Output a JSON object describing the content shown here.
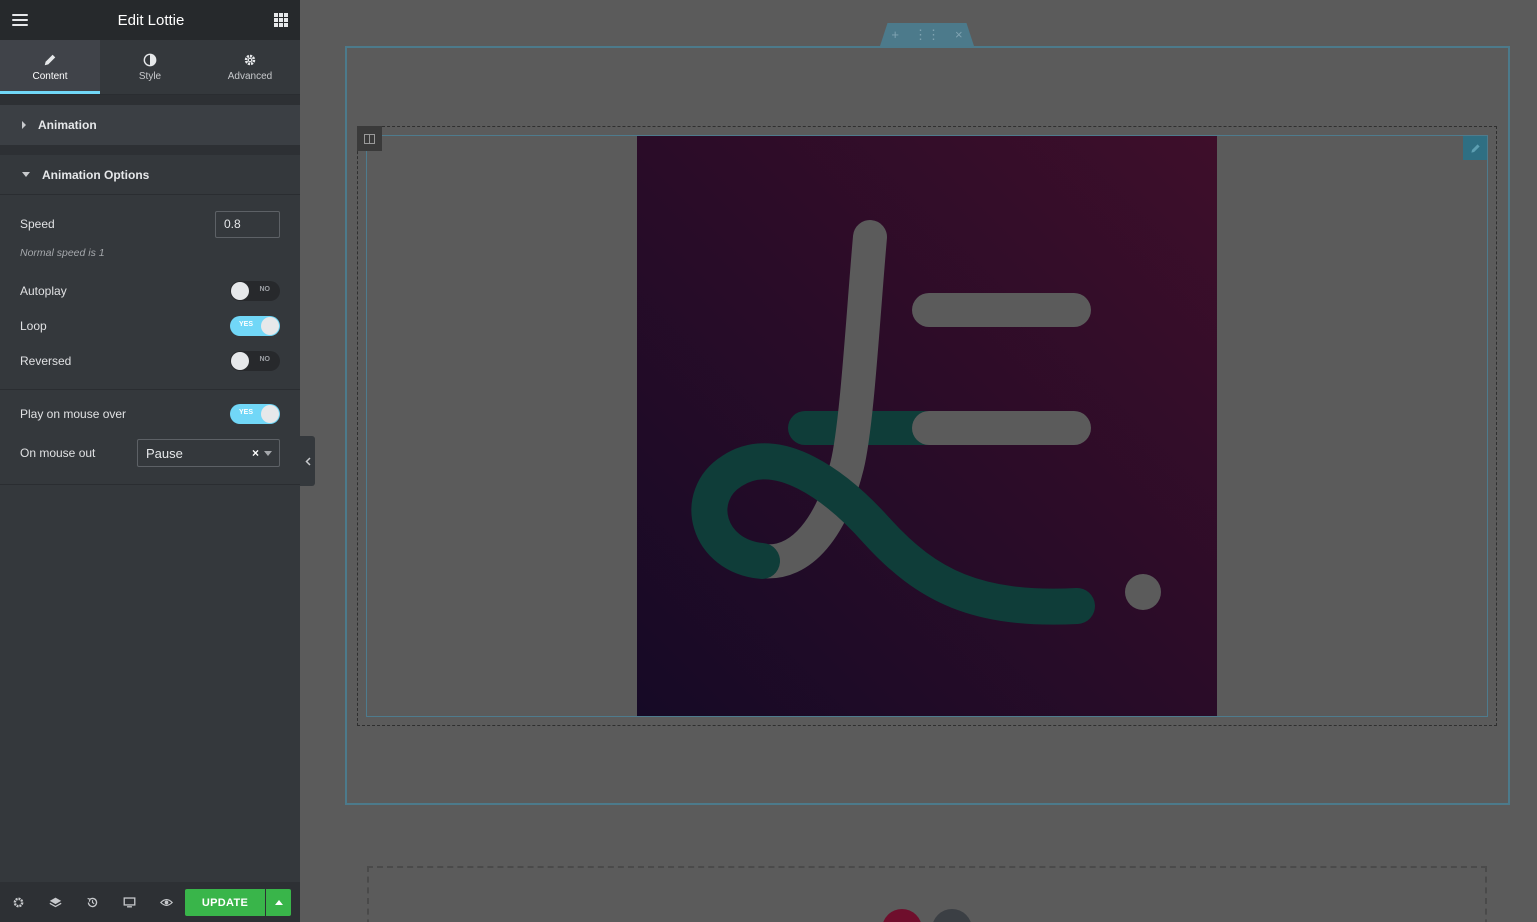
{
  "panel": {
    "title": "Edit Lottie",
    "tabs": [
      {
        "label": "Content",
        "icon": "pencil-icon",
        "active": true
      },
      {
        "label": "Style",
        "icon": "half-circle-icon"
      },
      {
        "label": "Advanced",
        "icon": "gear-icon"
      }
    ],
    "sections": {
      "animation": {
        "label": "Animation",
        "expanded": false
      },
      "animation_options": {
        "label": "Animation Options",
        "expanded": true
      }
    },
    "controls": {
      "speed": {
        "label": "Speed",
        "value": "0.8",
        "note": "Normal speed is 1"
      },
      "autoplay": {
        "label": "Autoplay",
        "state": "NO"
      },
      "loop": {
        "label": "Loop",
        "state": "YES"
      },
      "reversed": {
        "label": "Reversed",
        "state": "NO"
      },
      "play_on_mouse_over": {
        "label": "Play on mouse over",
        "state": "YES"
      },
      "on_mouse_out": {
        "label": "On mouse out",
        "value": "Pause",
        "clear": "×"
      }
    },
    "footer": {
      "icons": [
        "gear-icon",
        "layers-icon",
        "history-icon",
        "desktop-icon",
        "eye-icon"
      ],
      "update_label": "UPDATE"
    }
  },
  "canvas": {
    "section_handle_icons": [
      "+",
      "⋮⋮",
      "×"
    ],
    "colors": {
      "accent": "#71d7f7",
      "update": "#39b54a",
      "frame": "#4c7a8b",
      "art_teal": "#0f3d39",
      "art_gray": "#5b5b5b"
    }
  }
}
